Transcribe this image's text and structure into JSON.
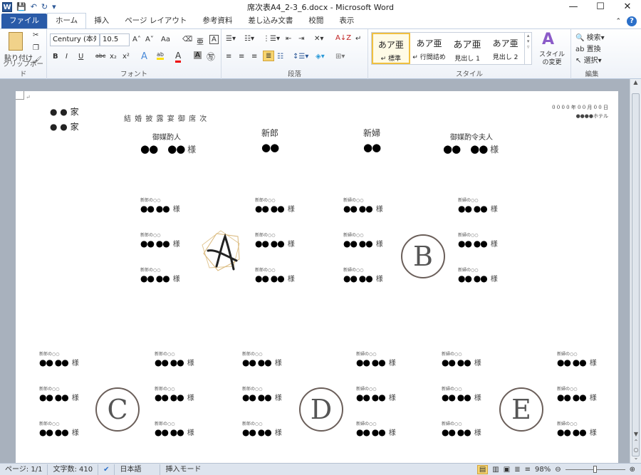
{
  "window": {
    "title": "席次表A4_2-3_6.docx - Microsoft Word",
    "app_icon": "W",
    "minimize": "—",
    "maximize": "☐",
    "close": "✕"
  },
  "quick_access": {
    "save": "💾",
    "undo": "↶",
    "redo": "↻",
    "customize": "▾"
  },
  "tabs": [
    {
      "label": "ファイル"
    },
    {
      "label": "ホーム"
    },
    {
      "label": "挿入"
    },
    {
      "label": "ページ レイアウト"
    },
    {
      "label": "参考資料"
    },
    {
      "label": "差し込み文書"
    },
    {
      "label": "校閲"
    },
    {
      "label": "表示"
    }
  ],
  "ribbon": {
    "clipboard": {
      "label": "クリップボード",
      "paste": "貼り付け"
    },
    "font": {
      "label": "フォント",
      "font_name": "Century (本ﾀ",
      "font_size": "10.5",
      "grow": "A˄",
      "shrink": "A˅",
      "case": "Aa",
      "bold": "B",
      "italic": "I",
      "underline": "U",
      "strike": "abc",
      "sub": "x₂",
      "sup": "x²",
      "color": "A",
      "highlight": "ab",
      "shade": "A",
      "enclose": "㊢",
      "phonetic": "亜",
      "border": "A"
    },
    "paragraph": {
      "label": "段落",
      "sort": "A↓Z",
      "marks": "↵"
    },
    "styles": {
      "label": "スタイル",
      "items": [
        {
          "preview": "あア亜",
          "name": "↵ 標準"
        },
        {
          "preview": "あア亜",
          "name": "↵ 行間詰め"
        },
        {
          "preview": "あア亜",
          "name": "見出し 1"
        },
        {
          "preview": "あア亜",
          "name": "見出し 2"
        }
      ],
      "change": "スタイルの変更"
    },
    "editing": {
      "label": "編集",
      "find": "検索",
      "replace": "置換",
      "select": "選択"
    }
  },
  "document": {
    "families": [
      "● ● 家",
      "● ● 家"
    ],
    "title": "結 婚 披 露 宴 御 席 次",
    "date": "0 0 0 0 年 0 0 月 0 0 日",
    "venue": "●●●●ホテル",
    "head_table": [
      {
        "role": "御媒酌人",
        "name": "●●　●●",
        "honorific": "様"
      },
      {
        "role": "新郎",
        "name": "●●",
        "honorific": ""
      },
      {
        "role": "新婦",
        "name": "●●",
        "honorific": ""
      },
      {
        "role": "御媒酌令夫人",
        "name": "●●　●●",
        "honorific": "様"
      }
    ],
    "tables": [
      {
        "letter": "A",
        "logo": true,
        "seats": [
          {
            "role": "新郎の○○",
            "name": "●● ●●",
            "honorific": "様"
          },
          {
            "role": "新郎の○○",
            "name": "●● ●●",
            "honorific": "様"
          },
          {
            "role": "新郎の○○",
            "name": "●● ●●",
            "honorific": "様"
          },
          {
            "role": "新郎の○○",
            "name": "●● ●●",
            "honorific": "様"
          },
          {
            "role": "新郎の○○",
            "name": "●● ●●",
            "honorific": "様"
          },
          {
            "role": "新郎の○○",
            "name": "●● ●●",
            "honorific": "様"
          }
        ]
      },
      {
        "letter": "B",
        "logo": false,
        "seats": [
          {
            "role": "新婦の○○",
            "name": "●● ●●",
            "honorific": "様"
          },
          {
            "role": "新婦の○○",
            "name": "●● ●●",
            "honorific": "様"
          },
          {
            "role": "新婦の○○",
            "name": "●● ●●",
            "honorific": "様"
          },
          {
            "role": "新婦の○○",
            "name": "●● ●●",
            "honorific": "様"
          },
          {
            "role": "新婦の○○",
            "name": "●● ●●",
            "honorific": "様"
          },
          {
            "role": "新婦の○○",
            "name": "●● ●●",
            "honorific": "様"
          }
        ]
      },
      {
        "letter": "C",
        "logo": false,
        "seats": [
          {
            "role": "新郎の○○",
            "name": "●● ●●",
            "honorific": "様"
          },
          {
            "role": "新郎の○○",
            "name": "●● ●●",
            "honorific": "様"
          },
          {
            "role": "新郎の○○",
            "name": "●● ●●",
            "honorific": "様"
          },
          {
            "role": "新郎の○○",
            "name": "●● ●●",
            "honorific": "様"
          },
          {
            "role": "新郎の○○",
            "name": "●● ●●",
            "honorific": "様"
          },
          {
            "role": "新郎の○○",
            "name": "●● ●●",
            "honorific": "様"
          }
        ]
      },
      {
        "letter": "D",
        "logo": false,
        "seats": [
          {
            "role": "新郎の○○",
            "name": "●● ●●",
            "honorific": "様"
          },
          {
            "role": "新郎の○○",
            "name": "●● ●●",
            "honorific": "様"
          },
          {
            "role": "新郎の○○",
            "name": "●● ●●",
            "honorific": "様"
          },
          {
            "role": "新婦の○○",
            "name": "●● ●●",
            "honorific": "様"
          },
          {
            "role": "新婦の○○",
            "name": "●● ●●",
            "honorific": "様"
          },
          {
            "role": "新婦の○○",
            "name": "●● ●●",
            "honorific": "様"
          }
        ]
      },
      {
        "letter": "E",
        "logo": false,
        "seats": [
          {
            "role": "新婦の○○",
            "name": "●● ●●",
            "honorific": "様"
          },
          {
            "role": "新婦の○○",
            "name": "●● ●●",
            "honorific": "様"
          },
          {
            "role": "新婦の○○",
            "name": "●● ●●",
            "honorific": "様"
          },
          {
            "role": "新婦の○○",
            "name": "●● ●●",
            "honorific": "様"
          },
          {
            "role": "新婦の○○",
            "name": "●● ●●",
            "honorific": "様"
          },
          {
            "role": "新婦の○○",
            "name": "●● ●●",
            "honorific": "様"
          }
        ]
      }
    ]
  },
  "status": {
    "page": "ページ: 1/1",
    "words": "文字数: 410",
    "language": "日本語",
    "mode": "挿入モード",
    "zoom": "98%",
    "zoom_percent": 98
  },
  "colors": {
    "file_tab": "#2a5ba8",
    "page_bg": "#a8b1bd",
    "style_selected": "#f0c040",
    "logo_gold": "#d9b77a"
  }
}
